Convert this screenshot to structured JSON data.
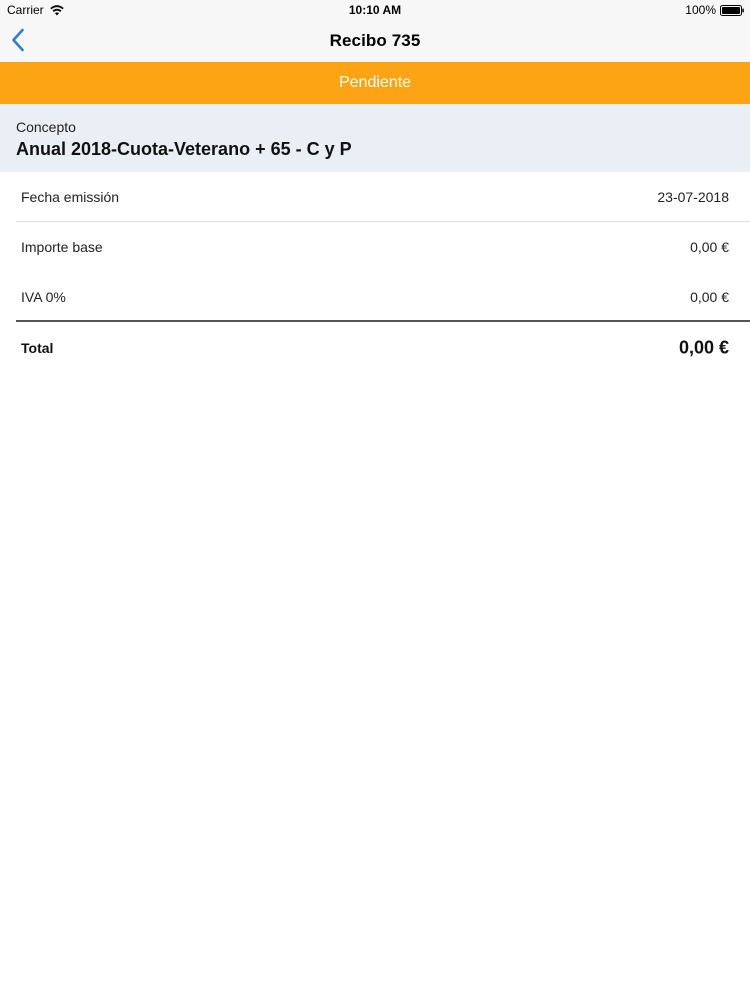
{
  "status_bar": {
    "carrier": "Carrier",
    "time": "10:10 AM",
    "battery": "100%"
  },
  "nav": {
    "title": "Recibo 735",
    "back_icon": "chevron-left-icon"
  },
  "banner": {
    "status": "Pendiente",
    "color": "#fca414"
  },
  "concept": {
    "label": "Concepto",
    "value": "Anual 2018-Cuota-Veterano + 65 - C y P"
  },
  "rows": [
    {
      "label": "Fecha emissión",
      "value": "23-07-2018"
    },
    {
      "label": "Importe base",
      "value": "0,00 €"
    },
    {
      "label": "IVA 0%",
      "value": "0,00 €"
    }
  ],
  "total": {
    "label": "Total",
    "value": "0,00 €"
  }
}
